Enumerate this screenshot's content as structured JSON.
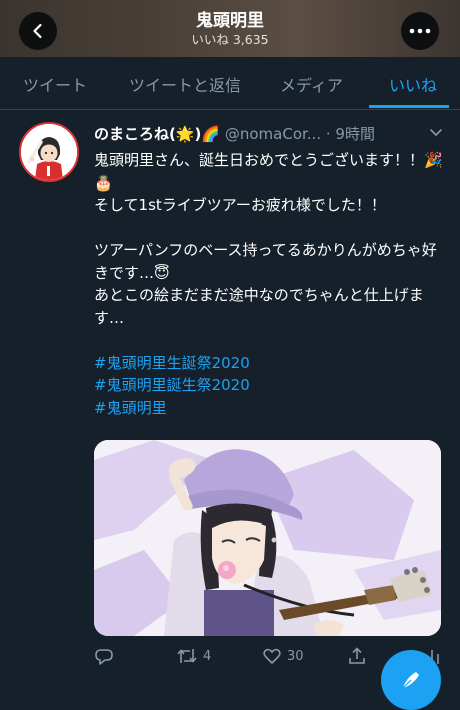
{
  "header": {
    "title": "鬼頭明里",
    "likes_count": "いいね 3,635",
    "back_icon": "chevron-left-icon",
    "more_icon": "more-dots-icon"
  },
  "tabs": [
    {
      "label": "ツイート",
      "active": false
    },
    {
      "label": "ツイートと返信",
      "active": false
    },
    {
      "label": "メディア",
      "active": false
    },
    {
      "label": "いいね",
      "active": true
    }
  ],
  "tweet": {
    "display_name": "のまころね(🌟)🌈",
    "handle": "@nomaCor...",
    "time": "· 9時間",
    "lines": [
      "鬼頭明里さん、誕生日おめでとうございます！！🎉🎂",
      "そして1stライブツアーお疲れ様でした！！",
      "ツアーパンフのベース持ってるあかりんがめちゃ好きです…😇",
      "あとこの絵まだまだ途中なのでちゃんと仕上げます…"
    ],
    "hashtags": [
      "#鬼頭明里生誕祭2020",
      "#鬼頭明里誕生祭2020",
      "#鬼頭明里"
    ],
    "retweets": "4",
    "likes": "30"
  },
  "colors": {
    "background": "#15202b",
    "accent": "#1da1f2",
    "muted": "#8899a6",
    "divider": "#38444d"
  }
}
